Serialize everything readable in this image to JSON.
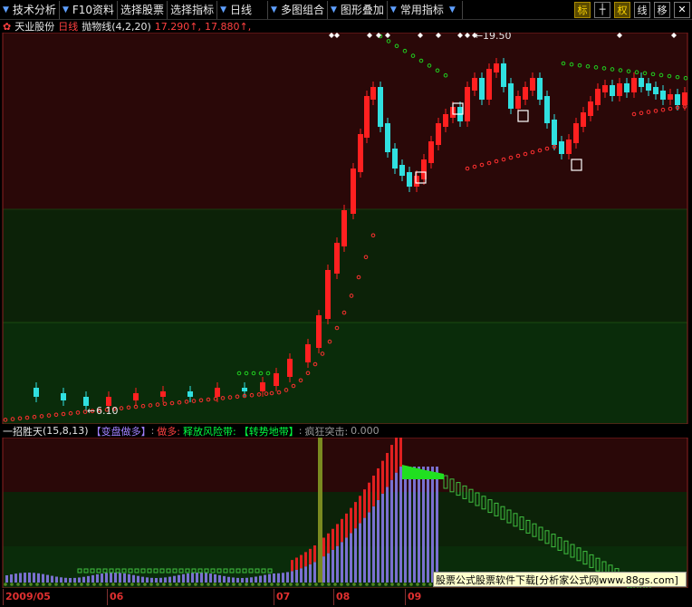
{
  "toolbar": {
    "buttons": [
      "技术分析",
      "F10资料",
      "选择股票",
      "选择指标",
      "日线",
      "多图组合",
      "图形叠加",
      "常用指标"
    ],
    "right_buttons": [
      "标",
      "权",
      "线",
      "移"
    ],
    "close_label": "✕"
  },
  "info": {
    "stock_name": "天业股份",
    "period": "日线",
    "indicator": "抛物线(4,2,20)",
    "value1": "17.290",
    "value2": "17.880",
    "arrow": "↑",
    "comma": ","
  },
  "main": {
    "high_label": "19.50",
    "low_label": "6.10",
    "colors": {
      "up": "#ff2020",
      "down": "#30e0e0",
      "sar_red": "#ff3030",
      "sar_green": "#20d020"
    }
  },
  "indicator_line": {
    "name": "一招胜天",
    "params": "(15,8,13)",
    "label1": "【变盘做多】",
    "label2": "做多:",
    "label3": "释放风险带:",
    "label4": "【转势地带】",
    "label5": "疯狂突击:",
    "value5": "0.000",
    "sep": ":"
  },
  "timeaxis": {
    "labels": [
      "2009/05",
      "06",
      "07",
      "08",
      "09"
    ]
  },
  "banner": {
    "text": "股票公式股票软件下载[分析家公式网www.88gs.com]"
  }
}
